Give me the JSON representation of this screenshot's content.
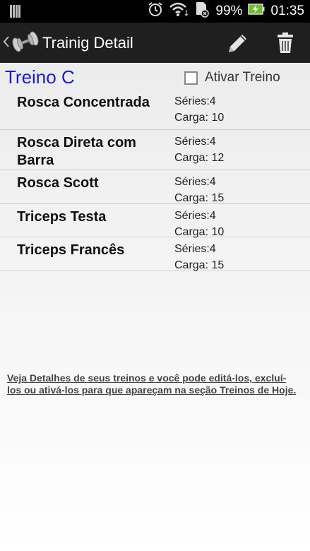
{
  "status_bar": {
    "battery_percent": "99%",
    "time": "01:35",
    "icons": [
      "bars-icon",
      "alarm-icon",
      "wifi-icon",
      "sd-card-icon",
      "battery-charging-icon"
    ]
  },
  "action_bar": {
    "title": "Trainig Detail",
    "icons": [
      "back-chevron-icon",
      "dumbbell-icon",
      "pencil-icon",
      "trash-icon"
    ],
    "accent": "#1f1f1f"
  },
  "workout": {
    "name": "Treino C",
    "name_color": "#1a1adf",
    "activate_label": "Ativar Treino",
    "activate_checked": false
  },
  "exercises": [
    {
      "name": "Rosca Concentrada",
      "series": "Séries:4",
      "load": "Carga: 10"
    },
    {
      "name": "Rosca Direta com Barra",
      "series": "Séries:4",
      "load": "Carga: 12"
    },
    {
      "name": "Rosca Scott",
      "series": "Séries:4",
      "load": "Carga: 15"
    },
    {
      "name": "Triceps Testa",
      "series": "Séries:4",
      "load": "Carga: 10"
    },
    {
      "name": "Triceps Francês",
      "series": "Séries:4",
      "load": "Carga: 15"
    }
  ],
  "footer": {
    "hint": "Veja Detalhes de seus treinos e você pode editá-los, excluí-los ou ativá-los para que apareçam na seção Treinos de Hoje."
  }
}
